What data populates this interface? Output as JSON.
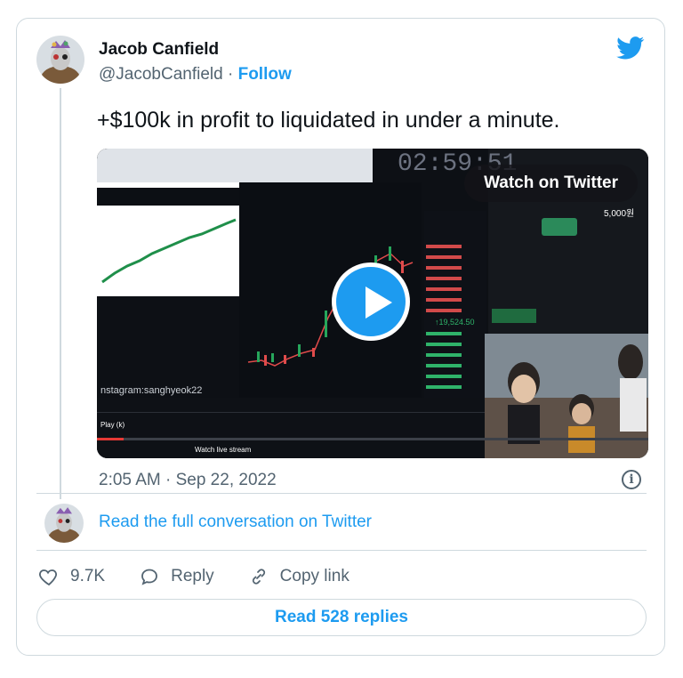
{
  "author": {
    "name": "Jacob Canfield",
    "handle": "@JacobCanfield",
    "separator": "·",
    "follow_label": "Follow"
  },
  "tweet": {
    "text": "+$100k in profit to liquidated in under a minute.",
    "timestamp": "2:05 AM · Sep 22, 2022"
  },
  "media": {
    "watch_label": "Watch on Twitter",
    "timer": "02:59:51",
    "instagram": "nstagram:sanghyeok22",
    "price_label": "↑19,524.50",
    "price_right": "5,000원",
    "watch_live": "Watch live stream",
    "play_label": "Play (k)"
  },
  "conversation": {
    "read_label": "Read the full conversation on Twitter"
  },
  "actions": {
    "likes_count": "9.7K",
    "reply_label": "Reply",
    "copy_label": "Copy link"
  },
  "replies_button": "Read 528 replies",
  "colors": {
    "accent": "#1d9bf0",
    "muted": "#536471",
    "border": "#cfd9de"
  }
}
